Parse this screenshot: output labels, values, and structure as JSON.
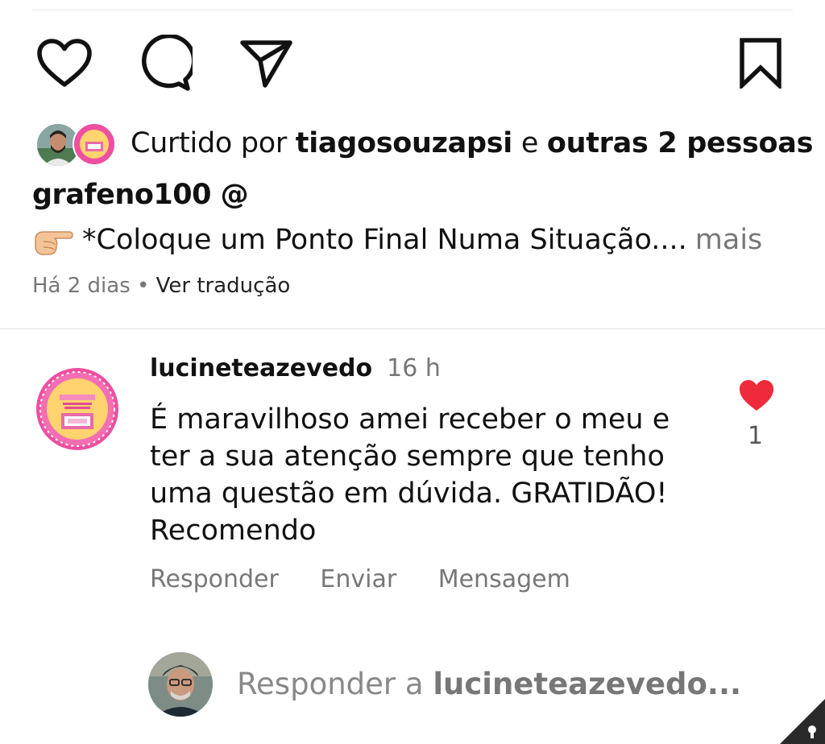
{
  "actions": {
    "like": "heart-outline-icon",
    "comment": "comment-bubble-icon",
    "share": "paper-plane-icon",
    "save": "bookmark-icon"
  },
  "likes": {
    "prefix": "Curtido por",
    "user": "tiagosouzapsi",
    "connector": "e",
    "others": "outras 2 pessoas"
  },
  "caption": {
    "username": "grafeno100 @",
    "emoji": "👉",
    "text": "*Coloque um Ponto Final Numa Situação....",
    "more": "mais"
  },
  "meta": {
    "time": "Há 2 dias",
    "separator": "•",
    "translate": "Ver tradução"
  },
  "comment": {
    "username": "lucineteazevedo",
    "time": "16 h",
    "text": "É maravilhoso amei receber o meu e ter a sua atenção sempre que tenho uma questão em dúvida. GRATIDÃO! Recomendo",
    "like_count": "1",
    "heart_color": "#ee2a3c",
    "actions": [
      "Responder",
      "Enviar",
      "Mensagem"
    ]
  },
  "reply": {
    "prefix": "Responder a",
    "user": "lucineteazevedo..."
  }
}
